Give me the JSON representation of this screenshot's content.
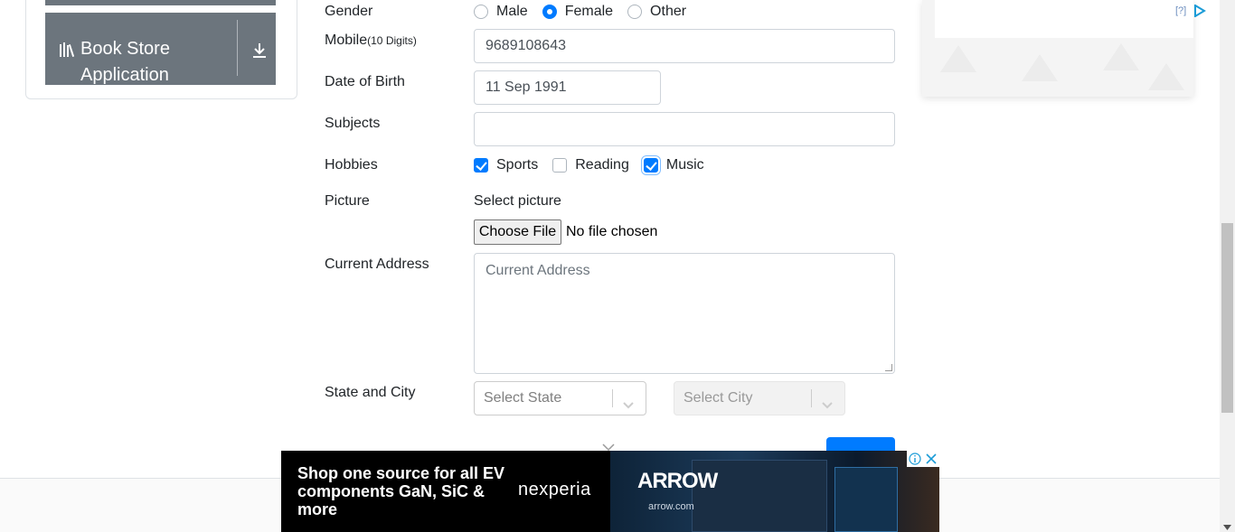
{
  "sidebar": {
    "active_item_label": "Book Store Application"
  },
  "form": {
    "gender_label": "Gender",
    "gender_options": [
      "Male",
      "Female",
      "Other"
    ],
    "gender_selected": "Female",
    "mobile_label": "Mobile",
    "mobile_hint": "(10 Digits)",
    "mobile_value": "9689108643",
    "dob_label": "Date of Birth",
    "dob_value": "11 Sep 1991",
    "subjects_label": "Subjects",
    "subjects_value": "",
    "hobbies_label": "Hobbies",
    "hobbies": [
      {
        "label": "Sports",
        "checked": true
      },
      {
        "label": "Reading",
        "checked": false
      },
      {
        "label": "Music",
        "checked": true
      }
    ],
    "picture_label": "Picture",
    "picture_prompt": "Select picture",
    "file_button": "Choose File",
    "file_status": "No file chosen",
    "address_label": "Current Address",
    "address_placeholder": "Current Address",
    "state_city_label": "State and City",
    "state_placeholder": "Select State",
    "city_placeholder": "Select City"
  },
  "ads": {
    "right_marker": "[?]",
    "bottom_copy": "Shop one source for all EV components GaN, SiC & more",
    "bottom_brand": "nexperia",
    "bottom_partner": "ARROW",
    "bottom_partner_url": "arrow.com"
  },
  "colors": {
    "accent": "#007bff",
    "sidebar_item_bg": "#6c757d"
  }
}
